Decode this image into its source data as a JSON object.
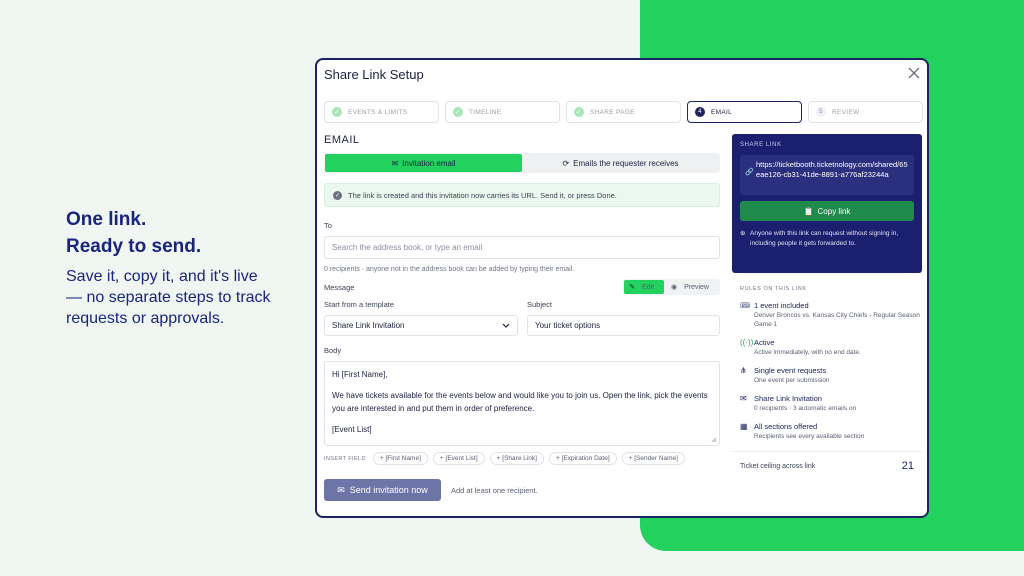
{
  "hero": {
    "line1": "One link.",
    "line2": "Ready to send.",
    "body": "Save it, copy it, and it's live — no separate steps to track requests or approvals."
  },
  "modal": {
    "title": "Share Link Setup",
    "steps": [
      {
        "label": "EVENTS & LIMITS",
        "state": "done",
        "marker": "✓"
      },
      {
        "label": "TIMELINE",
        "state": "done",
        "marker": "✓"
      },
      {
        "label": "SHARE PAGE",
        "state": "done",
        "marker": "✓"
      },
      {
        "label": "EMAIL",
        "state": "active",
        "marker": "4"
      },
      {
        "label": "REVIEW",
        "state": "pending",
        "marker": "5"
      }
    ],
    "section_title": "EMAIL",
    "tabs": {
      "invitation": "Invitation email",
      "requester": "Emails the requester receives"
    },
    "notice": "The link is created and this invitation now carries its URL. Send it, or press Done.",
    "to_label": "To",
    "to_placeholder": "Search the address book, or type an email",
    "recipients_hint": "0 recipients · anyone not in the address book can be added by typing their email.",
    "message_label": "Message",
    "edit_label": "Edit",
    "preview_label": "Preview",
    "template_label": "Start from a template",
    "template_value": "Share Link Invitation",
    "subject_label": "Subject",
    "subject_value": "Your ticket options",
    "body_label": "Body",
    "body_greeting": "Hi [First Name],",
    "body_para": "We have tickets available for the events below and would like you to join us. Open the link, pick the events you are interested in and put them in order of preference.",
    "body_list": "[Event List]",
    "insert_label": "INSERT FIELD",
    "insert_fields": [
      "[First Name]",
      "[Event List]",
      "[Share Link]",
      "[Expiration Date]",
      "[Sender Name]"
    ],
    "send_label": "Send invitation now",
    "send_hint": "Add at least one recipient."
  },
  "share_panel": {
    "heading": "SHARE LINK",
    "url": "https://ticketbooth.ticketnology.com/shared/65eae126-cb31-41de-8891-a776af23244a",
    "copy_label": "Copy link",
    "note": "Anyone with this link can request without signing in, including people it gets forwarded to."
  },
  "rules": {
    "heading": "RULES ON THIS LINK",
    "items": [
      {
        "icon": "ticket-icon",
        "title": "1 event included",
        "desc": "Denver Broncos vs. Kansas City Chiefs - Regular Season Game 1"
      },
      {
        "icon": "broadcast-icon",
        "title": "Active",
        "desc": "Active immediately, with no end date."
      },
      {
        "icon": "hierarchy-icon",
        "title": "Single event requests",
        "desc": "One event per submission"
      },
      {
        "icon": "envelope-icon",
        "title": "Share Link Invitation",
        "desc": "0 recipients · 3 automatic emails on"
      },
      {
        "icon": "grid-icon",
        "title": "All sections offered",
        "desc": "Recipients see every available section"
      }
    ],
    "ceiling_label": "Ticket ceiling across link",
    "ceiling_value": "21"
  }
}
